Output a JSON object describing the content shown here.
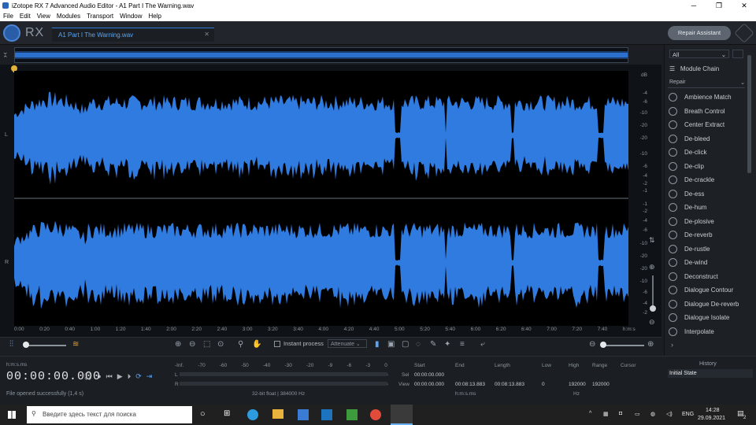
{
  "window": {
    "title": "iZotope RX 7 Advanced Audio Editor - A1 Part I The Warning.wav"
  },
  "menu": [
    "File",
    "Edit",
    "View",
    "Modules",
    "Transport",
    "Window",
    "Help"
  ],
  "header": {
    "logo_text": "RX",
    "file_tab": "A1 Part I The Warning.wav",
    "repair_assistant": "Repair Assistant"
  },
  "waveform": {
    "channels": [
      "L",
      "R"
    ],
    "db_scale_top": [
      "dB",
      "-4",
      "-6",
      "-10",
      "-20",
      "-20",
      "-10",
      "-6",
      "-4",
      "-2",
      "-1"
    ],
    "db_scale_bottom": [
      "-1",
      "-2",
      "-4",
      "-6",
      "-10",
      "-20",
      "-20",
      "-10",
      "-6",
      "-4",
      "-2"
    ],
    "timeline": [
      "0:00",
      "0:20",
      "0:40",
      "1:00",
      "1:20",
      "1:40",
      "2:00",
      "2:20",
      "2:40",
      "3:00",
      "3:20",
      "3:40",
      "4:00",
      "4:20",
      "4:40",
      "5:00",
      "5:20",
      "5:40",
      "6:00",
      "6:20",
      "6:40",
      "7:00",
      "7:20",
      "7:40",
      "h:m:s"
    ],
    "color": "#2f7be0"
  },
  "toolbar": {
    "instant_process": "Instant process",
    "attenuate": "Attenuate"
  },
  "modules": {
    "filter": "All",
    "module_chain": "Module Chain",
    "category": "Repair",
    "items": [
      "Ambience Match",
      "Breath Control",
      "Center Extract",
      "De-bleed",
      "De-click",
      "De-clip",
      "De-crackle",
      "De-ess",
      "De-hum",
      "De-plosive",
      "De-reverb",
      "De-rustle",
      "De-wind",
      "Deconstruct",
      "Dialogue Contour",
      "Dialogue De-reverb",
      "Dialogue Isolate",
      "Interpolate"
    ]
  },
  "transport": {
    "format_label": "h:m:s.ms",
    "timecode": "00:00:00.000",
    "status": "File opened successfully (1,4 s)"
  },
  "meter": {
    "scale": [
      "-Inf.",
      "-70",
      "-60",
      "-50",
      "-40",
      "-30",
      "-20",
      "-9",
      "-6",
      "-3",
      "0"
    ],
    "l": "L",
    "r": "R",
    "format": "32-bit float | 384000 Hz"
  },
  "selection": {
    "headers": [
      "Start",
      "End",
      "Length",
      "Low",
      "High",
      "Range",
      "Cursor"
    ],
    "sel_label": "Sel",
    "view_label": "View",
    "sel": {
      "start": "00:00:00.000",
      "end": "",
      "length": ""
    },
    "view": {
      "start": "00:00:00.000",
      "end": "00:08:13.883",
      "length": "00:08:13.883",
      "low": "0",
      "high": "192000",
      "range": "192000"
    },
    "sel_unit": "h:m:s.ms",
    "freq_unit": "Hz"
  },
  "history": {
    "title": "History",
    "items": [
      "Initial State"
    ]
  },
  "taskbar": {
    "search_placeholder": "Введите здесь текст для поиска",
    "lang": "ENG",
    "time": "14:28",
    "date": "29.09.2021",
    "notifications": "2"
  }
}
